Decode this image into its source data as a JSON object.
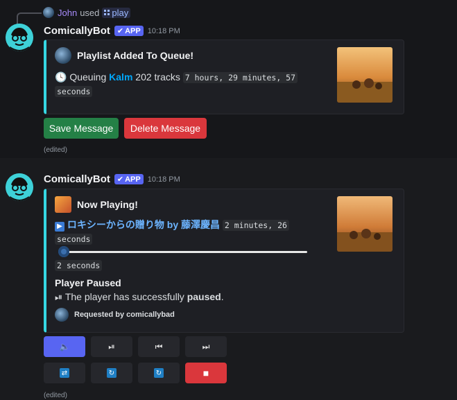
{
  "messages": [
    {
      "reply": {
        "user": "John",
        "used": "used",
        "command": "play"
      },
      "bot": {
        "name": "ComicallyBot",
        "badge": "APP",
        "time": "10:18 PM"
      },
      "embed": {
        "title": "Playlist Added To Queue!",
        "queuing_label": "Queuing",
        "playlist_name": "Kalm",
        "tracks_text": "202 tracks",
        "duration_code_1": "7 hours, 29 minutes, 57",
        "duration_code_2": "seconds"
      },
      "buttons": {
        "save": "Save Message",
        "delete": "Delete Message"
      },
      "edited": "(edited)"
    },
    {
      "bot": {
        "name": "ComicallyBot",
        "badge": "APP",
        "time": "10:18 PM"
      },
      "embed": {
        "title": "Now Playing!",
        "track": "ロキシーからの贈り物 by 藤澤慶昌",
        "track_duration_1": "2 minutes, 26",
        "track_duration_2": "seconds",
        "elapsed": "2 seconds",
        "progress": 0.015,
        "status_title": "Player Paused",
        "status_prefix": "The player has successfully",
        "status_bold": "paused",
        "status_suffix": ".",
        "requested_by": "Requested by comicallybad"
      },
      "controls": [
        {
          "icon": "volume-icon",
          "glyph": "🔈",
          "style": "blue"
        },
        {
          "icon": "play-pause-icon",
          "glyph": "⏯",
          "style": "grey"
        },
        {
          "icon": "previous-track-icon",
          "glyph": "⏮",
          "style": "grey"
        },
        {
          "icon": "next-track-icon",
          "glyph": "⏭",
          "style": "grey"
        },
        {
          "icon": "shuffle-icon",
          "glyph": "🔀",
          "style": "grey"
        },
        {
          "icon": "repeat-icon",
          "glyph": "🔁",
          "style": "grey"
        },
        {
          "icon": "repeat-one-icon",
          "glyph": "🔁",
          "style": "grey"
        },
        {
          "icon": "stop-icon",
          "glyph": "■",
          "style": "red"
        }
      ],
      "edited": "(edited)"
    }
  ],
  "colors": {
    "accent": "#35d7e3",
    "blurple": "#5865f2",
    "green": "#248046",
    "red": "#da373c",
    "link": "#00a8fc"
  }
}
